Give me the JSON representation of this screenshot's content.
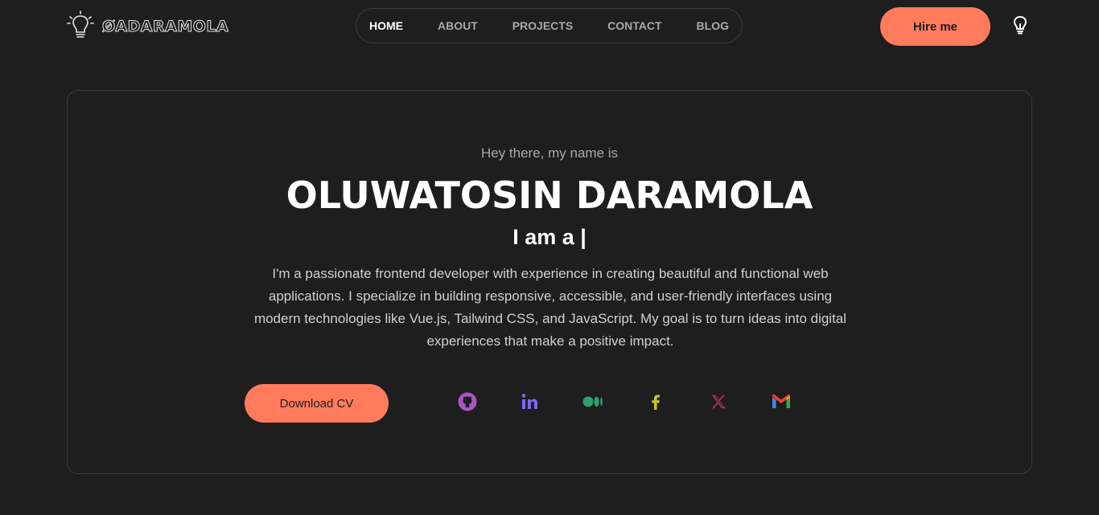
{
  "header": {
    "logo_text": "ØADARAMOLA",
    "nav": [
      {
        "label": "HOME",
        "active": true
      },
      {
        "label": "ABOUT",
        "active": false
      },
      {
        "label": "PROJECTS",
        "active": false
      },
      {
        "label": "CONTACT",
        "active": false
      },
      {
        "label": "BLOG",
        "active": false
      }
    ],
    "hire_label": "Hire me",
    "theme_icon": "lightbulb-icon"
  },
  "hero": {
    "greeting": "Hey there, my name is",
    "name": "OLUWATOSIN DARAMOLA",
    "role_prefix": "I am a |",
    "description": "I'm a passionate frontend developer with experience in creating beautiful and functional web applications. I specialize in building responsive, accessible, and user-friendly interfaces using modern technologies like Vue.js, Tailwind CSS, and JavaScript. My goal is to turn ideas into digital experiences that make a positive impact.",
    "cv_label": "Download CV",
    "socials": [
      {
        "icon": "github-icon",
        "color": "#a855c8"
      },
      {
        "icon": "linkedin-icon",
        "color": "#7b68ee"
      },
      {
        "icon": "medium-icon",
        "color": "#2e9e6a"
      },
      {
        "icon": "facebook-icon",
        "color": "#c8c820"
      },
      {
        "icon": "x-icon",
        "color": "#b0305a"
      },
      {
        "icon": "gmail-icon",
        "color": "#ea4335"
      }
    ]
  },
  "colors": {
    "background": "#1e1e1e",
    "accent": "#ff7b5c"
  }
}
